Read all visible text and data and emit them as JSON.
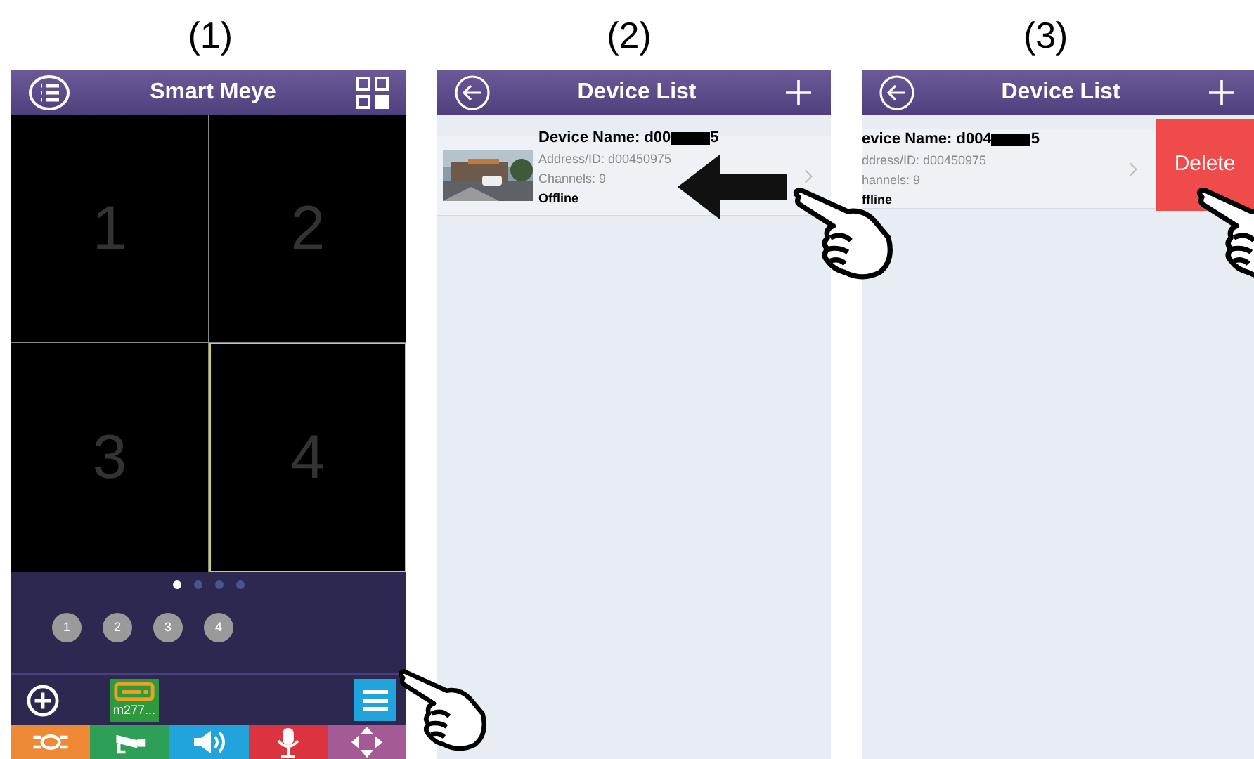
{
  "step_labels": [
    "(1)",
    "(2)",
    "(3)"
  ],
  "screen_1": {
    "title": "Smart Meye",
    "cells": [
      {
        "label": "1",
        "selected": false
      },
      {
        "label": "2",
        "selected": false
      },
      {
        "label": "3",
        "selected": false
      },
      {
        "label": "4",
        "selected": true
      }
    ],
    "pages": [
      {
        "selected": true
      },
      {
        "selected": false
      },
      {
        "selected": false
      },
      {
        "selected": false
      }
    ],
    "channels": [
      "1",
      "2",
      "3",
      "4"
    ],
    "device": "m277...",
    "controls": [
      {
        "kind": "ptz",
        "color": "#ee8a36"
      },
      {
        "kind": "camera",
        "color": "#2e9f57"
      },
      {
        "kind": "speaker",
        "color": "#21a3db"
      },
      {
        "kind": "mic",
        "color": "#dc343f"
      },
      {
        "kind": "arrows",
        "color": "#a45a94"
      }
    ]
  },
  "screen_2": {
    "title": "Device List",
    "device": {
      "name": "Device Name: d00",
      "name_end": "5",
      "address": "Address/ID: d00450975",
      "channels": "Channels: 9",
      "status": "Offline"
    }
  },
  "screen_3": {
    "title": "Device List",
    "device": {
      "name": "evice Name: d004",
      "name_end": "5",
      "address": "ddress/ID: d00450975",
      "channels": "hannels: 9",
      "status": "ffline"
    },
    "delete": "Delete"
  }
}
